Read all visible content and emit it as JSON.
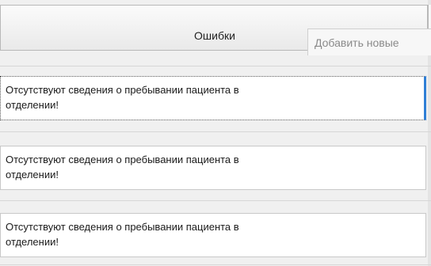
{
  "header": {
    "title": "Ошибки"
  },
  "tooltip": {
    "text": "Добавить новые"
  },
  "rows": [
    {
      "text": "Отсутствуют сведения о пребывании пациента в\nотделении!",
      "selected": true
    },
    {
      "text": "Отсутствуют сведения о пребывании пациента в\nотделении!",
      "selected": false
    },
    {
      "text": "Отсутствуют сведения о пребывании пациента в\nотделении!",
      "selected": false
    }
  ],
  "colors": {
    "selection_accent": "#2f7fd6",
    "tooltip_text": "#8a8a8a"
  }
}
